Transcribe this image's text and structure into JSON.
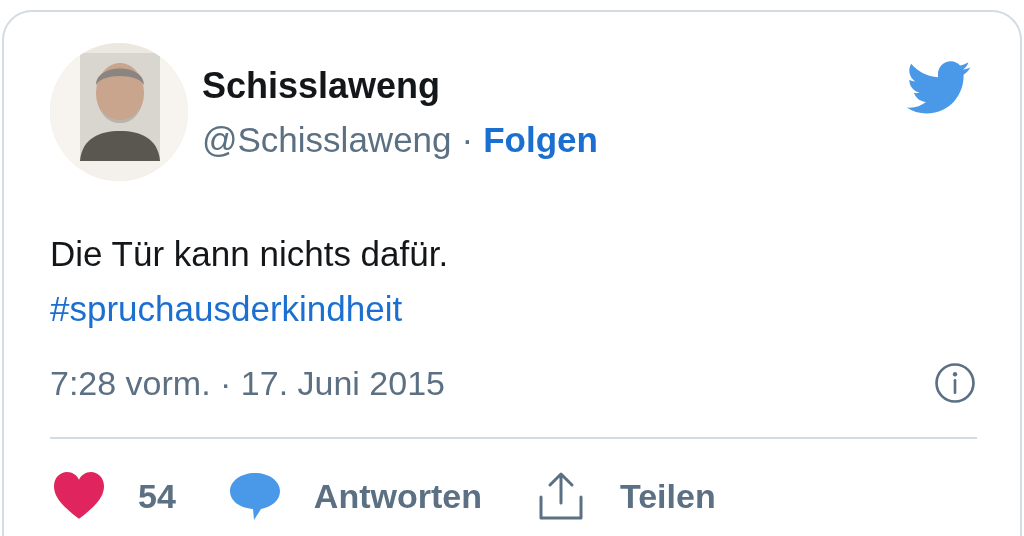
{
  "author": {
    "name": "Schisslaweng",
    "handle": "@Schisslaweng",
    "separator": "·",
    "follow": "Folgen"
  },
  "text": "Die Tür kann nichts dafür.",
  "hashtag": "#spruchausderkindheit",
  "timestamp": "7:28 vorm. · 17. Juni 2015",
  "actions": [
    {
      "kind": "like",
      "label": "54"
    },
    {
      "kind": "reply",
      "label": "Antworten"
    },
    {
      "kind": "share",
      "label": "Teilen"
    }
  ]
}
